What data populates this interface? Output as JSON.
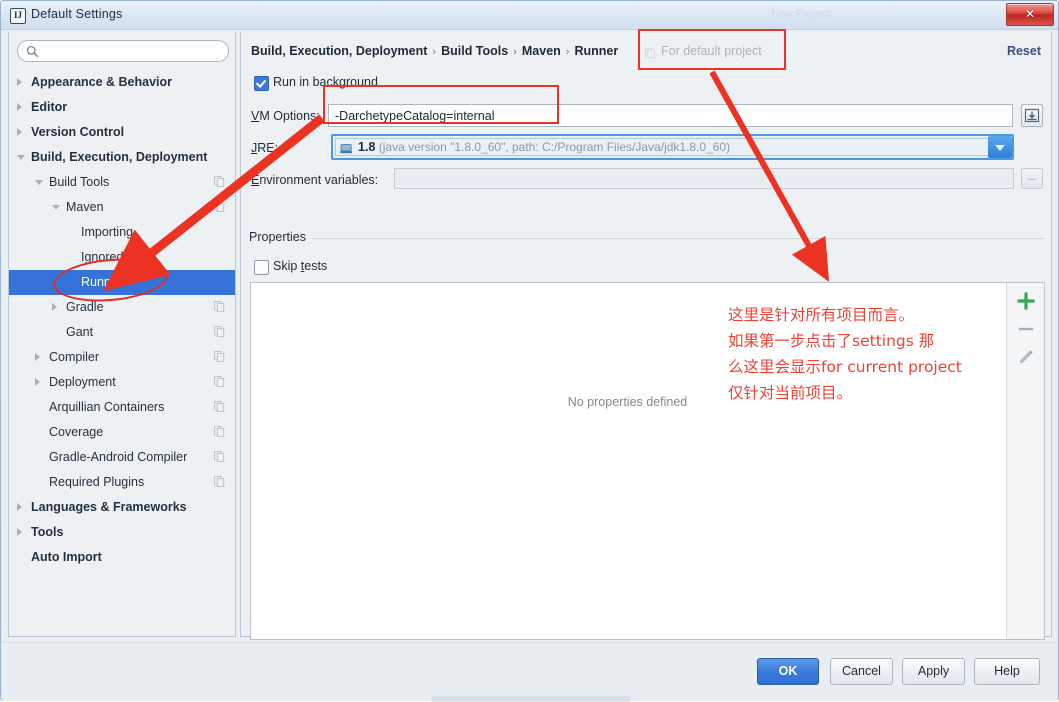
{
  "window": {
    "title": "Default Settings",
    "app_icon": "idea-icon",
    "close_label": "✕",
    "ghost_title": "New Project"
  },
  "sidebar": {
    "search": {
      "value": "",
      "placeholder": ""
    },
    "items": [
      {
        "label": "Appearance & Behavior",
        "indent": 22,
        "bold": true,
        "twisty": "closed",
        "copy": false,
        "selected": false
      },
      {
        "label": "Editor",
        "indent": 22,
        "bold": true,
        "twisty": "closed",
        "copy": false,
        "selected": false
      },
      {
        "label": "Version Control",
        "indent": 22,
        "bold": true,
        "twisty": "closed",
        "copy": false,
        "selected": false
      },
      {
        "label": "Build, Execution, Deployment",
        "indent": 22,
        "bold": true,
        "twisty": "open",
        "copy": false,
        "selected": false
      },
      {
        "label": "Build Tools",
        "indent": 40,
        "bold": false,
        "twisty": "open",
        "copy": true,
        "selected": false
      },
      {
        "label": "Maven",
        "indent": 57,
        "bold": false,
        "twisty": "open",
        "copy": true,
        "selected": false
      },
      {
        "label": "Importing",
        "indent": 72,
        "bold": false,
        "twisty": "none",
        "copy": false,
        "selected": false
      },
      {
        "label": "Ignored Files",
        "indent": 72,
        "bold": false,
        "twisty": "none",
        "copy": false,
        "selected": false
      },
      {
        "label": "Runner",
        "indent": 72,
        "bold": false,
        "twisty": "none",
        "copy": false,
        "selected": true
      },
      {
        "label": "Gradle",
        "indent": 57,
        "bold": false,
        "twisty": "closed",
        "copy": true,
        "selected": false
      },
      {
        "label": "Gant",
        "indent": 57,
        "bold": false,
        "twisty": "none",
        "copy": true,
        "selected": false
      },
      {
        "label": "Compiler",
        "indent": 40,
        "bold": false,
        "twisty": "closed",
        "copy": true,
        "selected": false
      },
      {
        "label": "Deployment",
        "indent": 40,
        "bold": false,
        "twisty": "closed",
        "copy": true,
        "selected": false
      },
      {
        "label": "Arquillian Containers",
        "indent": 40,
        "bold": false,
        "twisty": "none",
        "copy": true,
        "selected": false
      },
      {
        "label": "Coverage",
        "indent": 40,
        "bold": false,
        "twisty": "none",
        "copy": true,
        "selected": false
      },
      {
        "label": "Gradle-Android Compiler",
        "indent": 40,
        "bold": false,
        "twisty": "none",
        "copy": true,
        "selected": false
      },
      {
        "label": "Required Plugins",
        "indent": 40,
        "bold": false,
        "twisty": "none",
        "copy": true,
        "selected": false
      },
      {
        "label": "Languages & Frameworks",
        "indent": 22,
        "bold": true,
        "twisty": "closed",
        "copy": false,
        "selected": false
      },
      {
        "label": "Tools",
        "indent": 22,
        "bold": true,
        "twisty": "closed",
        "copy": false,
        "selected": false
      },
      {
        "label": "Auto Import",
        "indent": 22,
        "bold": true,
        "twisty": "none",
        "copy": false,
        "selected": false
      }
    ]
  },
  "pane": {
    "breadcrumb": [
      "Build, Execution, Deployment",
      "Build Tools",
      "Maven",
      "Runner"
    ],
    "breadcrumb_separator": "›",
    "scope_label": "For default project",
    "reset_label": "Reset",
    "run_in_background": {
      "label": "Run in background",
      "checked": true
    },
    "vm_options": {
      "label": "VM Options:",
      "label_mnemonic": "V",
      "value": "-DarchetypeCatalog=internal",
      "expand_icon": "expand-editor-icon"
    },
    "jre": {
      "label": "JRE:",
      "label_mnemonic": "J",
      "version": "1.8",
      "detail": "(java version \"1.8.0_60\", path: C:/Program Files/Java/jdk1.8.0_60)",
      "icon": "jdk-icon"
    },
    "env_vars": {
      "label": "Environment variables:",
      "label_mnemonic": "E",
      "value": "",
      "button_label": "..."
    },
    "properties": {
      "group_title": "Properties",
      "skip_tests": {
        "label": "Skip tests",
        "checked": false
      },
      "empty_message": "No properties defined",
      "toolbar": [
        {
          "name": "add-property-button",
          "glyph": "+",
          "color": "#3aa757"
        },
        {
          "name": "remove-property-button",
          "glyph": "–",
          "color": "#9aa3ab"
        },
        {
          "name": "edit-property-button",
          "glyph": "✎",
          "color": "#9aa3ab"
        }
      ]
    }
  },
  "footer": {
    "ok": "OK",
    "cancel": "Cancel",
    "apply": "Apply",
    "help": "Help"
  },
  "annotations": {
    "color": "#ec3223",
    "note_text": "这里是针对所有项目而言。\n如果第一步点击了settings 那\n么这里会显示for current project\n仅针对当前项目。",
    "boxes": [
      "scope-highlight-box",
      "vm-options-highlight-box"
    ],
    "ellipses": [
      "runner-highlight-ellipse"
    ],
    "arrows": [
      "arrow-to-vm-options",
      "arrow-to-runner",
      "arrow-to-properties"
    ]
  }
}
